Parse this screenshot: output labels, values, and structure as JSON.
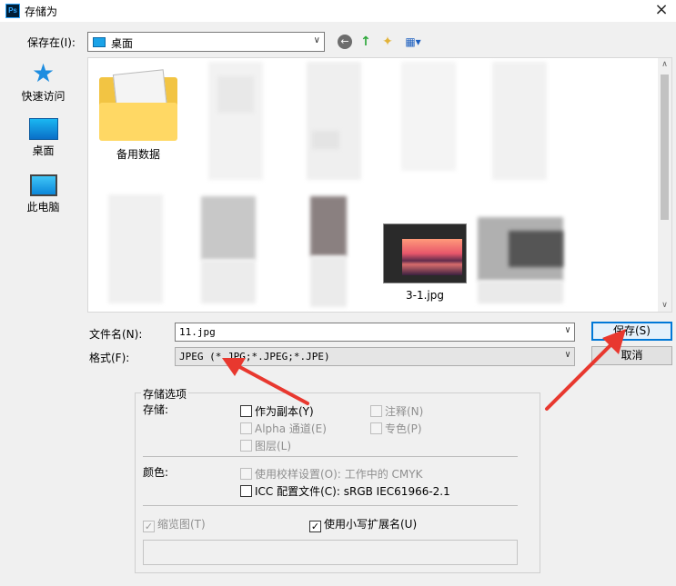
{
  "window": {
    "title": "存储为",
    "app_icon": "Ps",
    "close": "×"
  },
  "location": {
    "label": "保存在(I):",
    "value": "桌面"
  },
  "toolbar": {
    "back": "←",
    "up": "↑",
    "new_folder": "✦",
    "view": "▦▾"
  },
  "places": [
    {
      "label": "快速访问",
      "icon": "star-icon"
    },
    {
      "label": "桌面",
      "icon": "desktop-icon"
    },
    {
      "label": "此电脑",
      "icon": "computer-icon"
    }
  ],
  "files": [
    {
      "name": "备用数据",
      "type": "folder"
    },
    {
      "name": "3-1.jpg",
      "type": "image"
    }
  ],
  "filename": {
    "label": "文件名(N):",
    "value": "11.jpg"
  },
  "format": {
    "label": "格式(F):",
    "value": "JPEG (*.JPG;*.JPEG;*.JPE)"
  },
  "buttons": {
    "save": "保存(S)",
    "cancel": "取消"
  },
  "options": {
    "legend": "存储选项",
    "save_label": "存储:",
    "as_copy": "作为副本(Y)",
    "notes": "注释(N)",
    "alpha": "Alpha 通道(E)",
    "spot": "专色(P)",
    "layers": "图层(L)",
    "color_label": "颜色:",
    "proof": "使用校样设置(O):",
    "proof_value": "工作中的 CMYK",
    "icc": "ICC 配置文件(C):",
    "icc_value": "sRGB IEC61966-2.1",
    "thumbnail": "缩览图(T)",
    "lowercase": "使用小写扩展名(U)"
  },
  "colors": {
    "accent": "#0078d7",
    "annotation": "#e8382f"
  }
}
